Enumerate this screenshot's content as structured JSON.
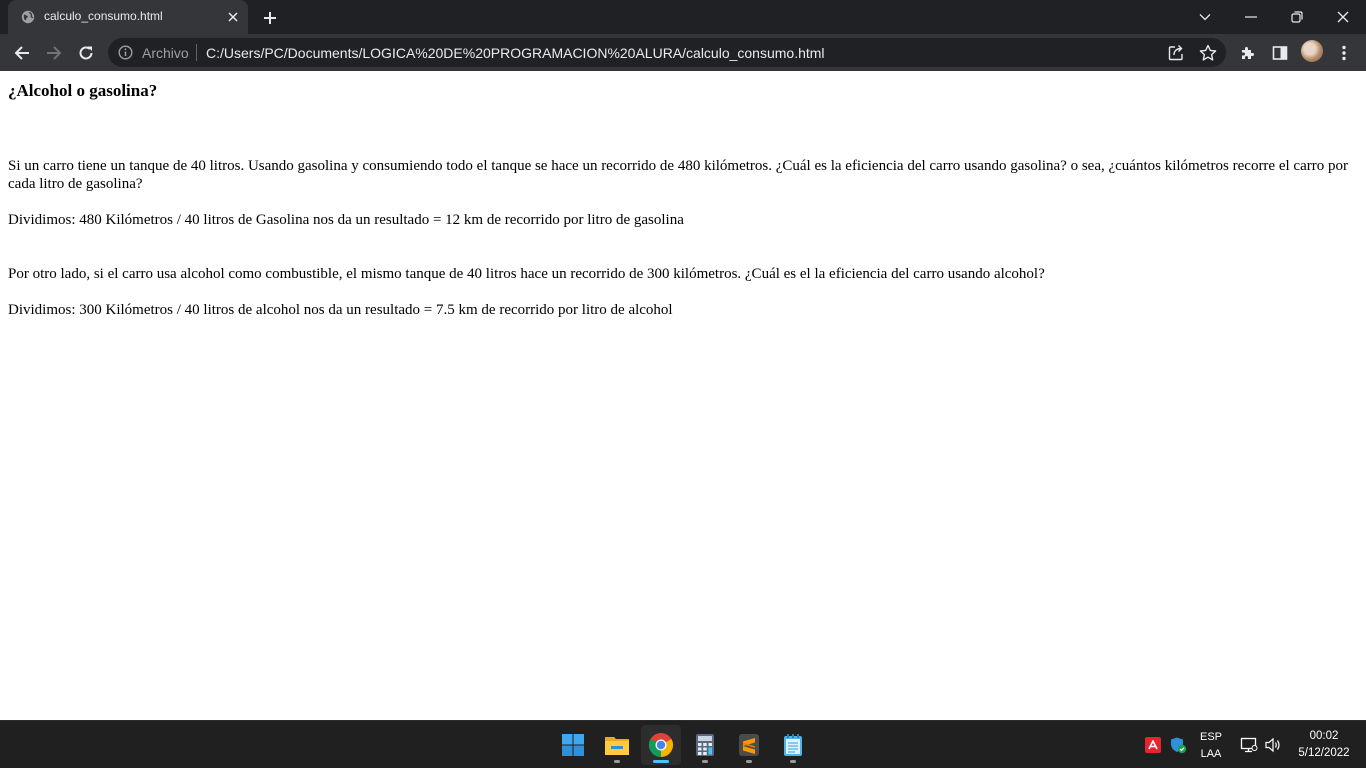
{
  "browser": {
    "tab": {
      "title": "calculo_consumo.html"
    },
    "toolbar": {
      "site_chip": "Archivo",
      "url": "C:/Users/PC/Documents/LOGICA%20DE%20PROGRAMACION%20ALURA/calculo_consumo.html"
    },
    "icons": [
      "globe-icon",
      "close-icon",
      "plus-icon",
      "chevron-down-icon",
      "minimize-icon",
      "restore-icon",
      "window-close-icon",
      "back-arrow-icon",
      "forward-arrow-icon",
      "reload-icon",
      "info-icon",
      "share-icon",
      "star-icon",
      "extensions-puzzle-icon",
      "side-panel-icon",
      "profile-avatar",
      "kebab-menu-icon"
    ],
    "accent": "#35363a"
  },
  "page": {
    "heading": "¿Alcohol o gasolina?",
    "paragraphs": [
      "Si un carro tiene un tanque de 40 litros. Usando gasolina y consumiendo todo el tanque se hace un recorrido de 480 kilómetros. ¿Cuál es la eficiencia del carro usando gasolina? o sea, ¿cuántos kilómetros recorre el carro por cada litro de gasolina?",
      "Dividimos: 480 Kilómetros / 40 litros de Gasolina nos da un resultado = 12 km de recorrido por litro de gasolina",
      "Por otro lado, si el carro usa alcohol como combustible, el mismo tanque de 40 litros hace un recorrido de 300 kilómetros. ¿Cuál es el la eficiencia del carro usando alcohol?",
      "Dividimos: 300 Kilómetros / 40 litros de alcohol nos da un resultado = 7.5 km de recorrido por litro de alcohol"
    ]
  },
  "taskbar": {
    "apps": [
      "windows-start-icon",
      "file-explorer-icon",
      "chrome-icon",
      "calculator-icon",
      "sublime-text-icon",
      "notepad-icon"
    ],
    "active_app": "chrome-icon",
    "tray": {
      "language": "ESP",
      "layout": "LAA",
      "time": "00:02",
      "date": "5/12/2022"
    }
  }
}
